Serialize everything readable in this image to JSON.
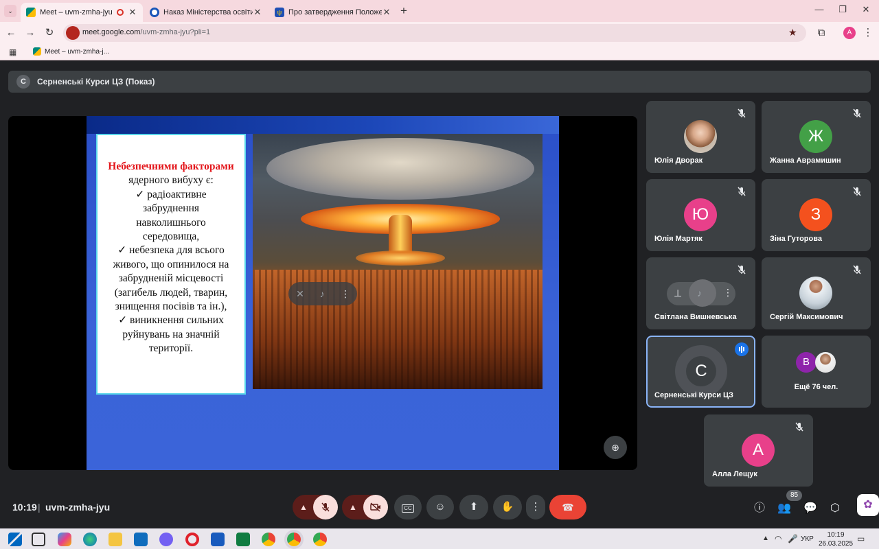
{
  "browser": {
    "tabs": [
      {
        "title": "Meet – uvm-zmha-jyu",
        "active": true,
        "favicon_color": "#00897b"
      },
      {
        "title": "Наказ Міністерства освіти і на",
        "active": false,
        "favicon_color": "#1a56b8"
      },
      {
        "title": "Про затвердження Положення",
        "active": false,
        "favicon_color": "#1f4fb4"
      }
    ],
    "url_host": "meet.google.com",
    "url_path": "/uvm-zmha-jyu?pli=1",
    "bookmark": "Meet – uvm-zmha-j...",
    "profile_initial": "A"
  },
  "meet": {
    "presenter_initial": "С",
    "presenter_title": "Серненські Курси ЦЗ (Показ)",
    "slide": {
      "heading": "Небезпечними факторами",
      "body": [
        "ядерного вибуху є:",
        "✓ радіоактивне",
        "забруднення",
        "навколишнього",
        "середовища,",
        "✓ небезпека  для всього",
        "живого, що опинилося  на",
        "забрудненій місцевості",
        "(загибель людей, тварин,",
        "знищення посівів та ін.),",
        "✓ виникнення сильних",
        "руйнувань на значній",
        "території."
      ]
    },
    "participants": [
      {
        "name": "Юлія Дворак",
        "initial": "",
        "color": "",
        "photo": true
      },
      {
        "name": "Жанна Аврамишин",
        "initial": "Ж",
        "color": "#43a047"
      },
      {
        "name": "Юлія Мартяк",
        "initial": "Ю",
        "color": "#e8408a"
      },
      {
        "name": "Зіна Гуторова",
        "initial": "З",
        "color": "#f4511e"
      },
      {
        "name": "Світлана Вишневська",
        "initial": "",
        "color": "#6d6f73"
      },
      {
        "name": "Сергій Максимович",
        "initial": "",
        "color": "",
        "photo": true
      },
      {
        "name": "Серненські Курси ЦЗ",
        "initial": "С",
        "color": "#3c4043"
      },
      {
        "name": "Ещё 76 чел.",
        "initial": "В",
        "color": "#8e24aa"
      },
      {
        "name": "Алла Лещук",
        "initial": "А",
        "color": "#e8408a"
      }
    ],
    "meeting_time": "10:19",
    "separator": "|",
    "meeting_code": "uvm-zmha-jyu",
    "people_count": "85"
  },
  "taskbar": {
    "language": "УКР",
    "time": "10:19",
    "date": "26.03.2025"
  }
}
